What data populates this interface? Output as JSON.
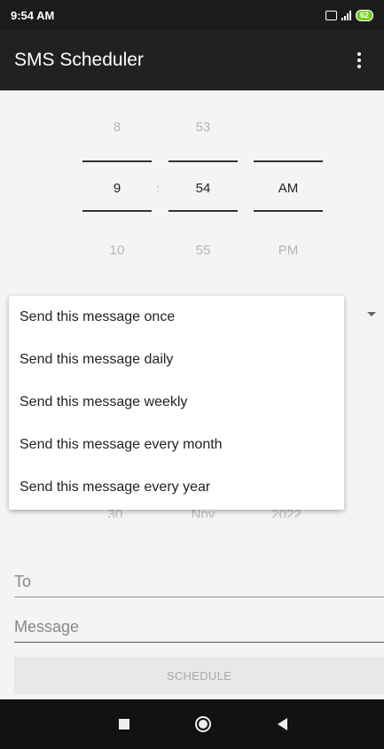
{
  "status_bar": {
    "time": "9:54 AM",
    "battery": "62"
  },
  "app_bar": {
    "title": "SMS Scheduler"
  },
  "time_picker": {
    "hour_prev": "8",
    "hour": "9",
    "hour_next": "10",
    "minute_prev": "53",
    "minute": "54",
    "minute_next": "55",
    "ampm": "AM",
    "ampm_next": "PM",
    "separator": ":"
  },
  "repeat_dropdown": {
    "options": [
      "Send this message once",
      "Send this message daily",
      "Send this message weekly",
      "Send this message every month",
      "Send this message every year"
    ]
  },
  "date_picker": {
    "day_next": "30",
    "month_next": "Nov",
    "year_next": "2022"
  },
  "form": {
    "to_placeholder": "To",
    "message_placeholder": "Message",
    "schedule_label": "SCHEDULE"
  },
  "colors": {
    "app_bar": "#212121",
    "status_bar": "#1b1b1b",
    "nav_bar": "#121212"
  }
}
